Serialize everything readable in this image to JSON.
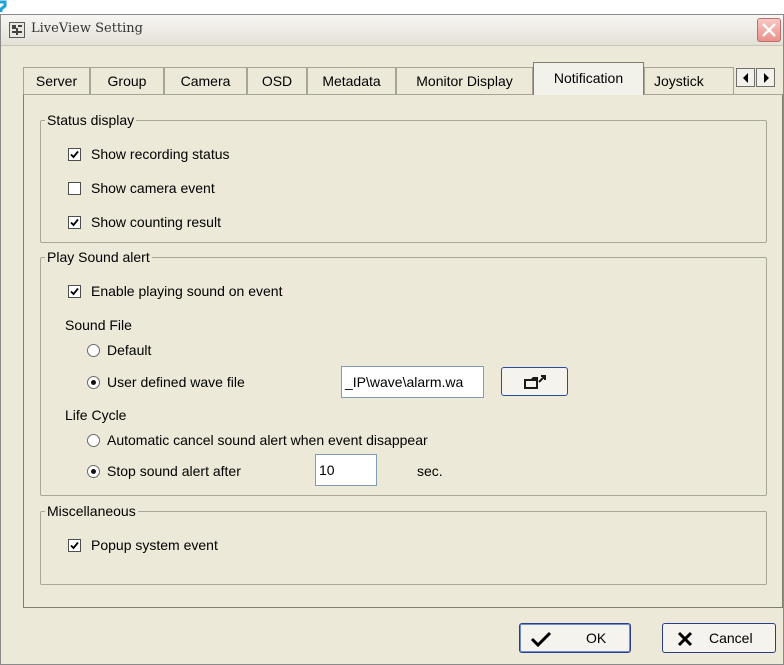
{
  "window": {
    "title": "LiveView Setting"
  },
  "tabs": [
    {
      "label": "Server",
      "active": false
    },
    {
      "label": "Group",
      "active": false
    },
    {
      "label": "Camera",
      "active": false
    },
    {
      "label": "OSD",
      "active": false
    },
    {
      "label": "Metadata",
      "active": false
    },
    {
      "label": "Monitor Display",
      "active": false
    },
    {
      "label": "Notification",
      "active": true
    },
    {
      "label": "Joystick",
      "active": false
    }
  ],
  "status_display": {
    "title": "Status display",
    "show_recording_status": {
      "label": "Show recording status",
      "checked": true
    },
    "show_camera_event": {
      "label": "Show camera event",
      "checked": false
    },
    "show_counting_result": {
      "label": "Show counting result",
      "checked": true
    }
  },
  "play_sound_alert": {
    "title": "Play Sound alert",
    "enable_playing": {
      "label": "Enable playing sound on event",
      "checked": true
    },
    "sound_file_label": "Sound File",
    "default_option": {
      "label": "Default",
      "selected": false
    },
    "user_defined_option": {
      "label": "User defined wave file",
      "selected": true
    },
    "wave_file_path": "_IP\\wave\\alarm.wa",
    "life_cycle_label": "Life Cycle",
    "auto_cancel_option": {
      "label": "Automatic cancel sound alert when event disappear",
      "selected": false
    },
    "stop_after_option": {
      "label": "Stop sound alert after",
      "selected": true
    },
    "stop_after_value": "10",
    "stop_after_unit": "sec."
  },
  "miscellaneous": {
    "title": "Miscellaneous",
    "popup_system_event": {
      "label": "Popup system event",
      "checked": true
    }
  },
  "buttons": {
    "ok": "OK",
    "cancel": "Cancel"
  },
  "colors": {
    "accent": "#1fa3d8",
    "close": "#e99089"
  },
  "icons": [
    "app-icon",
    "close-icon",
    "scroll-left-icon",
    "scroll-right-icon",
    "folder-open-icon",
    "checkmark-icon",
    "x-icon"
  ]
}
